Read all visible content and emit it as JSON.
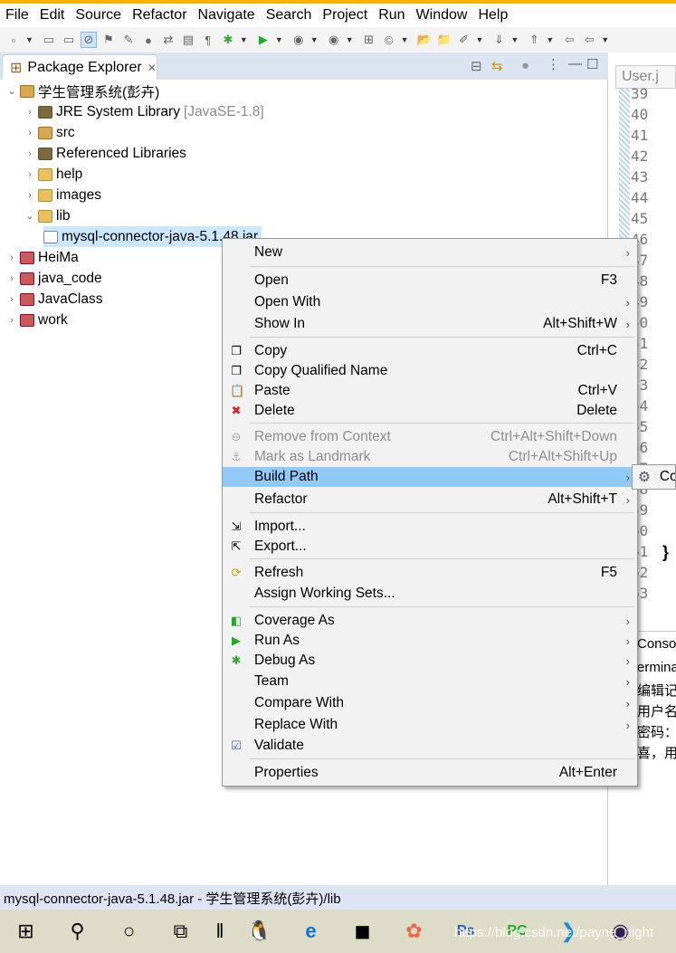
{
  "menubar": [
    "File",
    "Edit",
    "Source",
    "Refactor",
    "Navigate",
    "Search",
    "Project",
    "Run",
    "Window",
    "Help"
  ],
  "explorer": {
    "tab_label": "Package Explorer",
    "tree": [
      {
        "label": "学生管理系统(彭卉)",
        "level": 0,
        "expanded": true,
        "icon": "project-folder-icon"
      },
      {
        "label": "JRE System Library",
        "suffix": "[JavaSE-1.8]",
        "level": 1,
        "icon": "library-icon"
      },
      {
        "label": "src",
        "level": 1,
        "icon": "source-folder-icon"
      },
      {
        "label": "Referenced Libraries",
        "level": 1,
        "icon": "library-icon"
      },
      {
        "label": "help",
        "level": 1,
        "icon": "folder-icon"
      },
      {
        "label": "images",
        "level": 1,
        "icon": "folder-icon"
      },
      {
        "label": "lib",
        "level": 1,
        "expanded": true,
        "icon": "folder-icon"
      },
      {
        "label": "mysql-connector-java-5.1.48.jar",
        "level": 2,
        "selected": true,
        "icon": "jar-icon"
      },
      {
        "label": "HeiMa",
        "level": 0,
        "icon": "java-project-icon"
      },
      {
        "label": "java_code",
        "level": 0,
        "icon": "java-project-icon"
      },
      {
        "label": "JavaClass",
        "level": 0,
        "icon": "java-project-icon"
      },
      {
        "label": "work",
        "level": 0,
        "icon": "java-project-icon"
      }
    ]
  },
  "editor": {
    "tab_label": "User.j",
    "line_numbers": [
      "39",
      "40",
      "41",
      "42",
      "43",
      "44",
      "45",
      "46",
      "47",
      "48",
      "49",
      "50",
      "51",
      "52",
      "53",
      "54",
      "55",
      "56",
      "57",
      "58",
      "59",
      "60",
      "61",
      "62",
      "63"
    ],
    "brace": "}"
  },
  "console": {
    "tab_label": "Conso",
    "lines": [
      "ermina",
      "编辑记",
      "用户名",
      "密码：",
      "喜，用"
    ]
  },
  "context_menu": [
    {
      "label": "New",
      "submenu": true
    },
    {
      "sep": true
    },
    {
      "label": "Open",
      "accel": "F3"
    },
    {
      "label": "Open With",
      "submenu": true
    },
    {
      "label": "Show In",
      "accel": "Alt+Shift+W",
      "submenu": true
    },
    {
      "sep": true
    },
    {
      "label": "Copy",
      "accel": "Ctrl+C",
      "icon": "copy-icon"
    },
    {
      "label": "Copy Qualified Name",
      "icon": "copy-qualified-icon"
    },
    {
      "label": "Paste",
      "accel": "Ctrl+V",
      "icon": "paste-icon"
    },
    {
      "label": "Delete",
      "accel": "Delete",
      "icon": "delete-icon"
    },
    {
      "sep": true
    },
    {
      "label": "Remove from Context",
      "accel": "Ctrl+Alt+Shift+Down",
      "disabled": true,
      "icon": "remove-context-icon"
    },
    {
      "label": "Mark as Landmark",
      "accel": "Ctrl+Alt+Shift+Up",
      "disabled": true,
      "icon": "landmark-icon"
    },
    {
      "label": "Build Path",
      "submenu": true,
      "highlighted": true
    },
    {
      "label": "Refactor",
      "accel": "Alt+Shift+T",
      "submenu": true
    },
    {
      "sep": true
    },
    {
      "label": "Import...",
      "icon": "import-icon"
    },
    {
      "label": "Export...",
      "icon": "export-icon"
    },
    {
      "sep": true
    },
    {
      "label": "Refresh",
      "accel": "F5",
      "icon": "refresh-icon"
    },
    {
      "label": "Assign Working Sets..."
    },
    {
      "sep": true
    },
    {
      "label": "Coverage As",
      "submenu": true,
      "icon": "coverage-icon"
    },
    {
      "label": "Run As",
      "submenu": true,
      "icon": "run-icon"
    },
    {
      "label": "Debug As",
      "submenu": true,
      "icon": "debug-icon"
    },
    {
      "label": "Team",
      "submenu": true
    },
    {
      "label": "Compare With",
      "submenu": true
    },
    {
      "label": "Replace With",
      "submenu": true
    },
    {
      "label": "Validate",
      "icon": "validate-check-icon"
    },
    {
      "sep": true
    },
    {
      "label": "Properties",
      "accel": "Alt+Enter"
    }
  ],
  "submenu": {
    "label": "Co"
  },
  "status_bar": "mysql-connector-java-5.1.48.jar - 学生管理系统(彭卉)/lib",
  "watermark": "https://blog.csdn.net/payne_night",
  "colors": {
    "highlight": "#91c9f7",
    "status_bar": "#dde4f3",
    "taskbar": "#dcdcc8",
    "title_accent": "#f5b400"
  }
}
